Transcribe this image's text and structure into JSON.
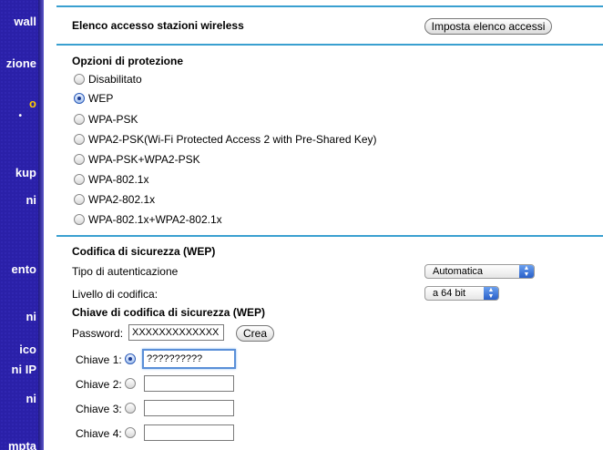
{
  "sidebar": {
    "items": [
      {
        "label": "wall"
      },
      {
        "label": "zione"
      },
      {
        "label": "o"
      },
      {
        "label": "kup"
      },
      {
        "label": "ni"
      },
      {
        "label": "ento"
      },
      {
        "label": "ni"
      },
      {
        "label": "ico"
      },
      {
        "label": "ni IP"
      },
      {
        "label": "ni"
      },
      {
        "label": "mpta"
      }
    ]
  },
  "access_list": {
    "label": "Elenco accesso stazioni wireless",
    "button_label": "Imposta elenco accessi"
  },
  "protection": {
    "heading": "Opzioni di protezione",
    "options": [
      {
        "label": "Disabilitato",
        "selected": false
      },
      {
        "label": "WEP",
        "selected": true
      },
      {
        "label": "WPA-PSK",
        "selected": false
      },
      {
        "label": "WPA2-PSK(Wi-Fi Protected Access 2 with Pre-Shared Key)",
        "selected": false
      },
      {
        "label": "WPA-PSK+WPA2-PSK",
        "selected": false
      },
      {
        "label": "WPA-802.1x",
        "selected": false
      },
      {
        "label": "WPA2-802.1x",
        "selected": false
      },
      {
        "label": "WPA-802.1x+WPA2-802.1x",
        "selected": false
      }
    ]
  },
  "wep": {
    "heading": "Codifica di sicurezza (WEP)",
    "auth_label": "Tipo di autenticazione",
    "auth_value": "Automatica",
    "level_label": "Livello di codifica:",
    "level_value": "a 64 bit",
    "key_heading": "Chiave di codifica di sicurezza (WEP)",
    "password_label": "Password:",
    "password_value": "XXXXXXXXXXXXX",
    "create_button": "Crea",
    "keys": [
      {
        "label": "Chiave 1:",
        "value": "??????????",
        "selected": true
      },
      {
        "label": "Chiave 2:",
        "value": "",
        "selected": false
      },
      {
        "label": "Chiave 3:",
        "value": "",
        "selected": false
      },
      {
        "label": "Chiave 4:",
        "value": "",
        "selected": false
      }
    ]
  }
}
